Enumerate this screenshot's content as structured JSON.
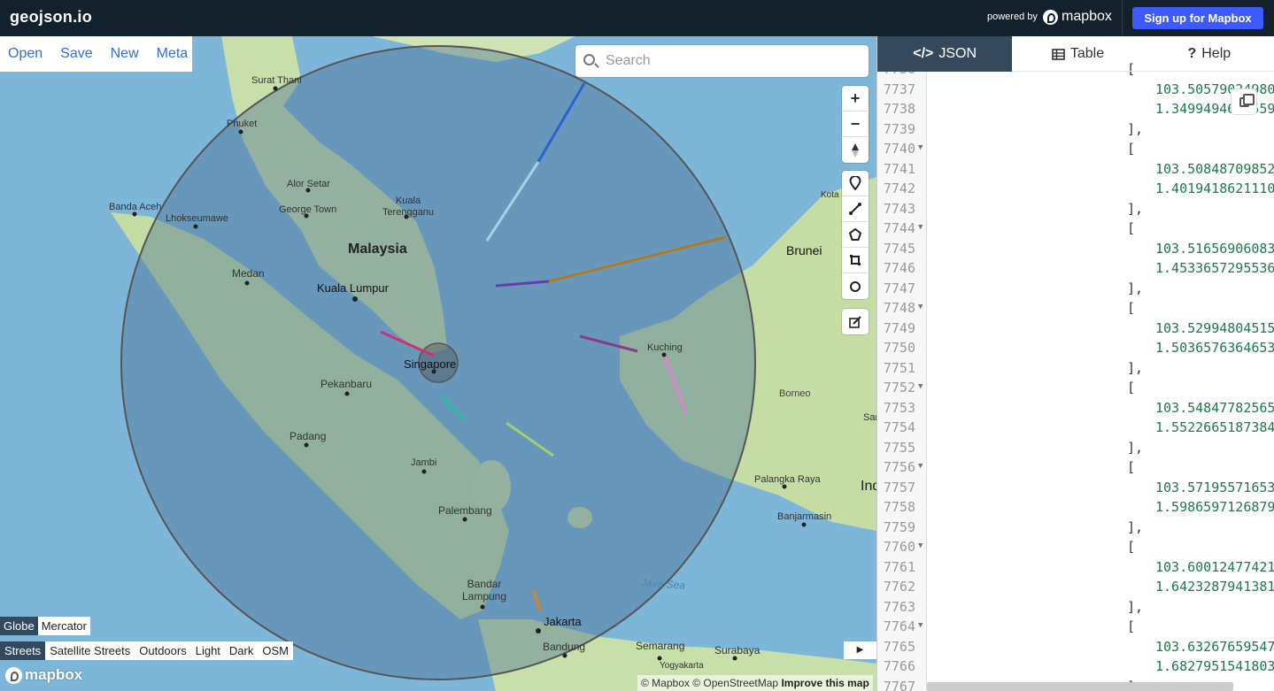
{
  "app": {
    "logo": "geojson.io",
    "powered_by": "powered by",
    "brand": "mapbox",
    "signup_label": "Sign up for Mapbox"
  },
  "menu": {
    "items": [
      "Open",
      "Save",
      "New",
      "Meta"
    ]
  },
  "search": {
    "placeholder": "Search"
  },
  "map_controls": {
    "zoom_in": "+",
    "zoom_out": "−"
  },
  "projection": {
    "options": [
      "Globe",
      "Mercator"
    ],
    "active": "Globe"
  },
  "styles": {
    "options": [
      "Streets",
      "Satellite Streets",
      "Outdoors",
      "Light",
      "Dark",
      "OSM"
    ],
    "active": "Streets"
  },
  "attribution": {
    "mapbox": "© Mapbox",
    "osm": "© OpenStreetMap",
    "improve": "Improve this map"
  },
  "map_labels": [
    "Surat Thani",
    "Phuket",
    "Alor Setar",
    "George Town",
    "Kuala Terengganu",
    "Banda Aceh",
    "Lhokseumawe",
    "Malaysia",
    "Medan",
    "Kuala Lumpur",
    "Singapore",
    "Pekanbaru",
    "Padang",
    "Jambi",
    "Palembang",
    "Bandar Lampung",
    "Jakarta",
    "Bandung",
    "Semarang",
    "Surabaya",
    "Yogyakarta",
    "Kuching",
    "Borneo",
    "Palangka Raya",
    "Banjarmasin",
    "Brunei",
    "Kota",
    "Java Sea",
    "Ind",
    "Sar"
  ],
  "panel": {
    "tabs": [
      "JSON",
      "Table",
      "Help"
    ],
    "active_tab": "JSON",
    "lines": [
      {
        "n": "7736",
        "fold": true,
        "code": "[",
        "num": ""
      },
      {
        "n": "7737",
        "fold": false,
        "code": "",
        "num": "103.50579024980"
      },
      {
        "n": "7738",
        "fold": false,
        "code": "",
        "num": "1.34994946095592"
      },
      {
        "n": "7739",
        "fold": false,
        "code": "],",
        "num": ""
      },
      {
        "n": "7740",
        "fold": true,
        "code": "[",
        "num": ""
      },
      {
        "n": "7741",
        "fold": false,
        "code": "",
        "num": "103.50848709852"
      },
      {
        "n": "7742",
        "fold": false,
        "code": "",
        "num": "1.4019418621110"
      },
      {
        "n": "7743",
        "fold": false,
        "code": "],",
        "num": ""
      },
      {
        "n": "7744",
        "fold": true,
        "code": "[",
        "num": ""
      },
      {
        "n": "7745",
        "fold": false,
        "code": "",
        "num": "103.51656906083"
      },
      {
        "n": "7746",
        "fold": false,
        "code": "",
        "num": "1.4533657295536"
      },
      {
        "n": "7747",
        "fold": false,
        "code": "],",
        "num": ""
      },
      {
        "n": "7748",
        "fold": true,
        "code": "[",
        "num": ""
      },
      {
        "n": "7749",
        "fold": false,
        "code": "",
        "num": "103.52994804515"
      },
      {
        "n": "7750",
        "fold": false,
        "code": "",
        "num": "1.5036576364653"
      },
      {
        "n": "7751",
        "fold": false,
        "code": "],",
        "num": ""
      },
      {
        "n": "7752",
        "fold": true,
        "code": "[",
        "num": ""
      },
      {
        "n": "7753",
        "fold": false,
        "code": "",
        "num": "103.54847782565"
      },
      {
        "n": "7754",
        "fold": false,
        "code": "",
        "num": "1.5522665187384"
      },
      {
        "n": "7755",
        "fold": false,
        "code": "],",
        "num": ""
      },
      {
        "n": "7756",
        "fold": true,
        "code": "[",
        "num": ""
      },
      {
        "n": "7757",
        "fold": false,
        "code": "",
        "num": "103.57195571653"
      },
      {
        "n": "7758",
        "fold": false,
        "code": "",
        "num": "1.5986597126879"
      },
      {
        "n": "7759",
        "fold": false,
        "code": "],",
        "num": ""
      },
      {
        "n": "7760",
        "fold": true,
        "code": "[",
        "num": ""
      },
      {
        "n": "7761",
        "fold": false,
        "code": "",
        "num": "103.60012477421"
      },
      {
        "n": "7762",
        "fold": false,
        "code": "",
        "num": "1.6423287941381"
      },
      {
        "n": "7763",
        "fold": false,
        "code": "],",
        "num": ""
      },
      {
        "n": "7764",
        "fold": true,
        "code": "[",
        "num": ""
      },
      {
        "n": "7765",
        "fold": false,
        "code": "",
        "num": "103.63267659547"
      },
      {
        "n": "7766",
        "fold": false,
        "code": "",
        "num": "1.6827951541803"
      },
      {
        "n": "7767",
        "fold": false,
        "code": "],",
        "num": ""
      }
    ]
  }
}
